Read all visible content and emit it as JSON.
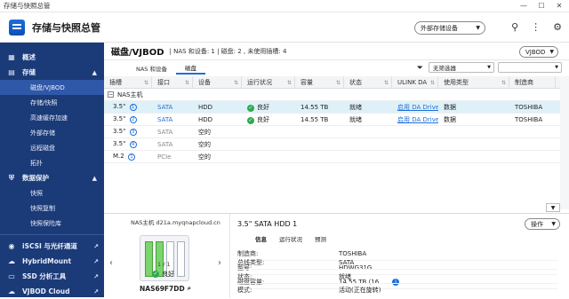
{
  "window": {
    "title": "存储与快照总管"
  },
  "app": {
    "title": "存储与快照总管",
    "external_btn": "外部存储设备"
  },
  "sidebar": {
    "overview": "概述",
    "storage": "存储",
    "storage_items": [
      "磁盘/VJBOD",
      "存储/快照",
      "高速缓存加速",
      "外部存储",
      "远程磁盘",
      "拓扑"
    ],
    "dataprot": "数据保护",
    "dataprot_items": [
      "快照",
      "快照复制",
      "快照保险库"
    ],
    "links": [
      "iSCSI 与光纤通道",
      "HybridMount",
      "SSD 分析工具",
      "VJBOD Cloud"
    ]
  },
  "main": {
    "title": "磁盘/VJBOD",
    "meta": "| NAS 和设备: 1 | 磁盘: 2 , 未使用插槽: 4",
    "vjbod_btn": "VJBOD",
    "tabs": [
      "NAS 和设备",
      "磁盘"
    ],
    "filter_select": "无筛选器",
    "columns": [
      "插槽",
      "接口",
      "设备",
      "运行状况",
      "容量",
      "状态",
      "ULINK DA",
      "使用类型",
      "制造商"
    ],
    "group": "NAS主机",
    "rows": [
      {
        "slot": "3.5\"",
        "badge": "1",
        "iface": "SATA",
        "dev": "HDD",
        "health": "良好",
        "cap": "14.55 TB",
        "status": "就绪",
        "ulink": "启用 DA Drive Analyzer",
        "use": "数据",
        "maker": "TOSHIBA"
      },
      {
        "slot": "3.5\"",
        "badge": "2",
        "iface": "SATA",
        "dev": "HDD",
        "health": "良好",
        "cap": "14.55 TB",
        "status": "就绪",
        "ulink": "启用 DA Drive Analyzer",
        "use": "数据",
        "maker": "TOSHIBA"
      },
      {
        "slot": "3.5\"",
        "badge": "3",
        "iface": "SATA",
        "dev": "空的",
        "health": "",
        "cap": "",
        "status": "",
        "ulink": "",
        "use": "",
        "maker": ""
      },
      {
        "slot": "3.5\"",
        "badge": "4",
        "iface": "SATA",
        "dev": "空的",
        "health": "",
        "cap": "",
        "status": "",
        "ulink": "",
        "use": "",
        "maker": ""
      },
      {
        "slot": "M.2",
        "badge": "1",
        "iface": "PCIe",
        "dev": "空的",
        "health": "",
        "cap": "",
        "status": "",
        "ulink": "",
        "use": "",
        "maker": ""
      }
    ]
  },
  "device": {
    "host": "NAS主机 d21a.myqnapcloud.cn",
    "name": "NAS69F7DD",
    "page": "1 / 1",
    "health": "良好"
  },
  "detail": {
    "title": "3.5\" SATA HDD 1",
    "op_btn": "操作",
    "tabs": [
      "信息",
      "运行状况",
      "预测"
    ],
    "props": [
      {
        "k": "制造商:",
        "v": "TOSHIBA"
      },
      {
        "k": "型号:",
        "v": "HDWG31G"
      },
      {
        "k": "磁盘容量:",
        "v": "14.55 TB (16 ..."
      },
      {
        "k": "总线类型:",
        "v": "SATA"
      },
      {
        "k": "状态:",
        "v": "就绪"
      },
      {
        "k": "模式:",
        "v": "活动(正在旋转)"
      }
    ]
  }
}
